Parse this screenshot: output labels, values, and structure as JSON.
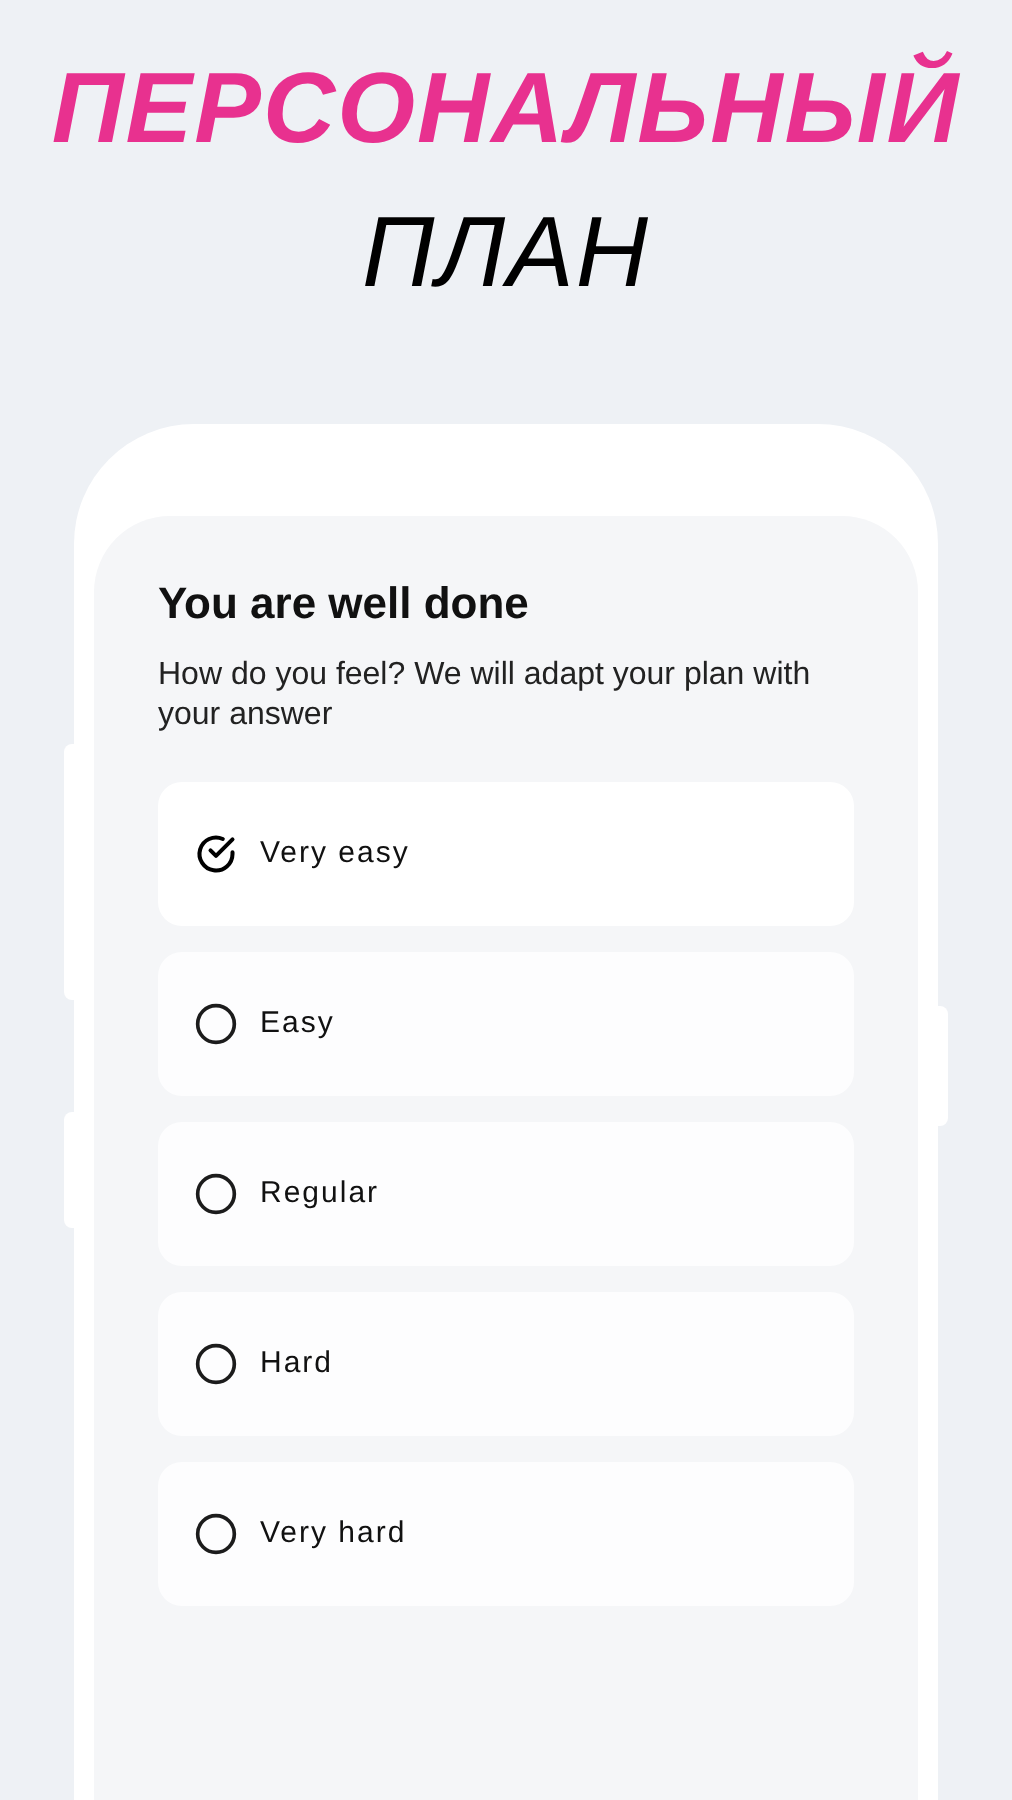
{
  "headline": {
    "line_1": "ПЕРСОНАЛЬНЫЙ",
    "line_2": "ПЛАН"
  },
  "screen": {
    "title": "You are well done",
    "subtitle": "How do you feel? We will adapt your plan with your answer",
    "options": [
      {
        "label": "Very easy",
        "selected": true
      },
      {
        "label": "Easy",
        "selected": false
      },
      {
        "label": "Regular",
        "selected": false
      },
      {
        "label": "Hard",
        "selected": false
      },
      {
        "label": "Very hard",
        "selected": false
      }
    ]
  }
}
